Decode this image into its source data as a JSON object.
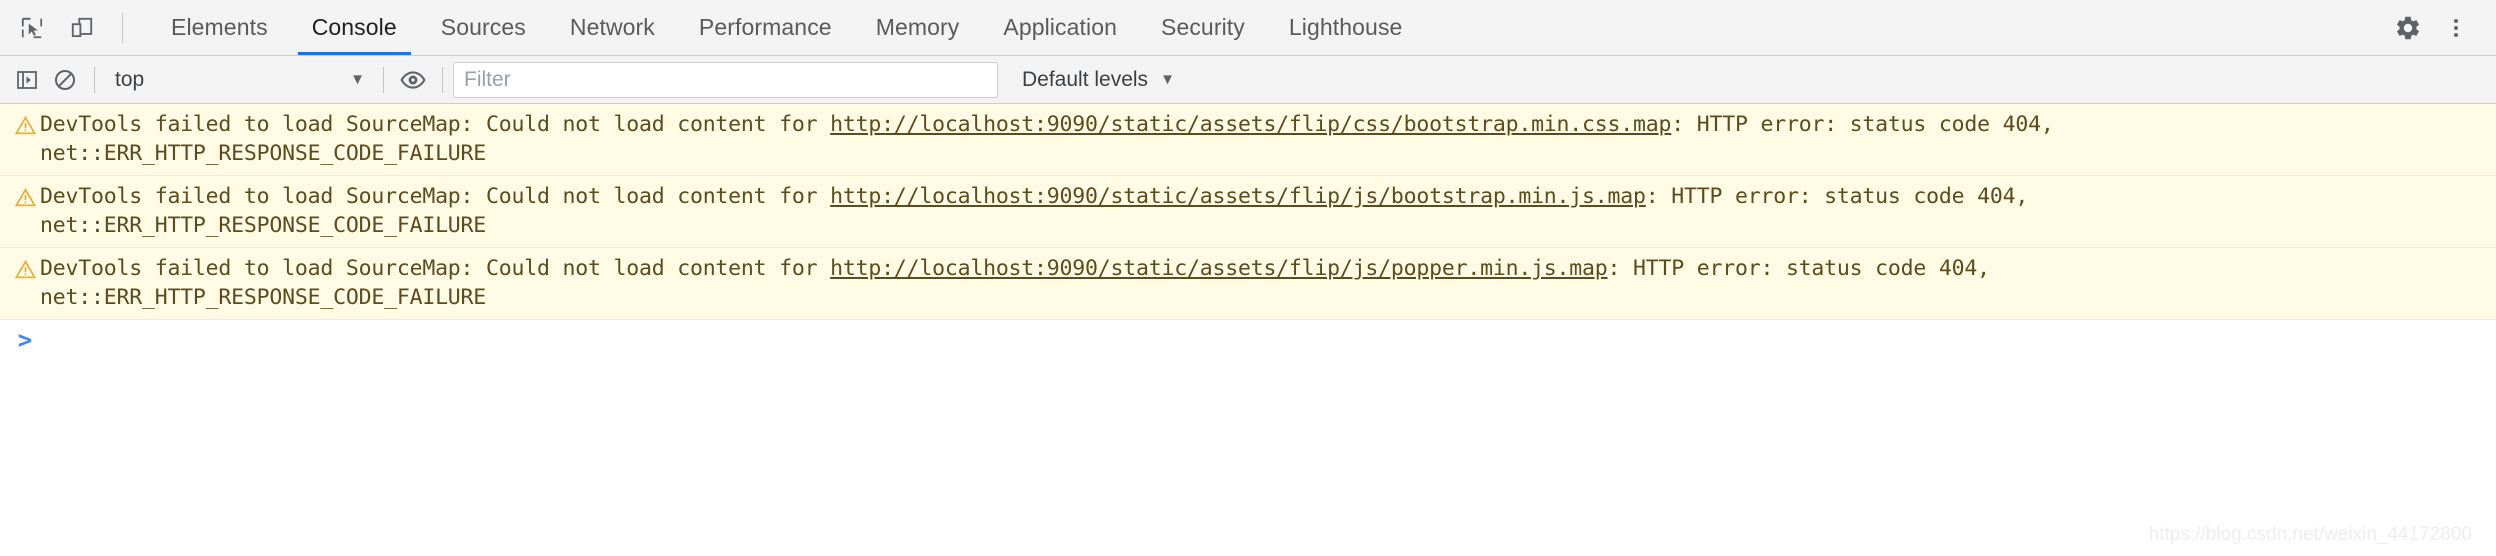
{
  "window": {
    "title": "Chrome DevTools — Console"
  },
  "tabbar": {
    "inspect_icon": "inspect-cursor-icon",
    "device_toggle_icon": "device-toolbar-icon",
    "tabs": [
      {
        "label": "Elements",
        "active": false
      },
      {
        "label": "Console",
        "active": true
      },
      {
        "label": "Sources",
        "active": false
      },
      {
        "label": "Network",
        "active": false
      },
      {
        "label": "Performance",
        "active": false
      },
      {
        "label": "Memory",
        "active": false
      },
      {
        "label": "Application",
        "active": false
      },
      {
        "label": "Security",
        "active": false
      },
      {
        "label": "Lighthouse",
        "active": false
      }
    ],
    "settings_icon": "gear-icon",
    "more_icon": "kebab-menu-icon",
    "active_indicator_color": "#1a73e8"
  },
  "toolbar": {
    "sidebar_toggle_icon": "console-sidebar-icon",
    "clear_icon": "clear-console-icon",
    "context": {
      "value": "top",
      "caret": "▼"
    },
    "eye_icon": "live-expression-icon",
    "filter": {
      "placeholder": "Filter",
      "value": ""
    },
    "levels": {
      "label": "Default levels",
      "caret": "▼"
    }
  },
  "console": {
    "messages": [
      {
        "level": "warning",
        "icon": "warning-triangle-icon",
        "prefix": "DevTools failed to load SourceMap: Could not load content for ",
        "url": "http://localhost:9090/static/assets/flip/css/bootstrap.min.css.map",
        "suffix": ": HTTP error: status code 404,",
        "line2": "net::ERR_HTTP_RESPONSE_CODE_FAILURE"
      },
      {
        "level": "warning",
        "icon": "warning-triangle-icon",
        "prefix": "DevTools failed to load SourceMap: Could not load content for ",
        "url": "http://localhost:9090/static/assets/flip/js/bootstrap.min.js.map",
        "suffix": ": HTTP error: status code 404,",
        "line2": "net::ERR_HTTP_RESPONSE_CODE_FAILURE"
      },
      {
        "level": "warning",
        "icon": "warning-triangle-icon",
        "prefix": "DevTools failed to load SourceMap: Could not load content for ",
        "url": "http://localhost:9090/static/assets/flip/js/popper.min.js.map",
        "suffix": ": HTTP error: status code 404,",
        "line2": "net::ERR_HTTP_RESPONSE_CODE_FAILURE"
      }
    ],
    "prompt": {
      "chevron": ">",
      "input_value": ""
    },
    "warning_bg_color": "#fffbe5",
    "warning_text_color": "#5c4b1e"
  },
  "watermark": {
    "text": "https://blog.csdn.net/weixin_44172800"
  }
}
